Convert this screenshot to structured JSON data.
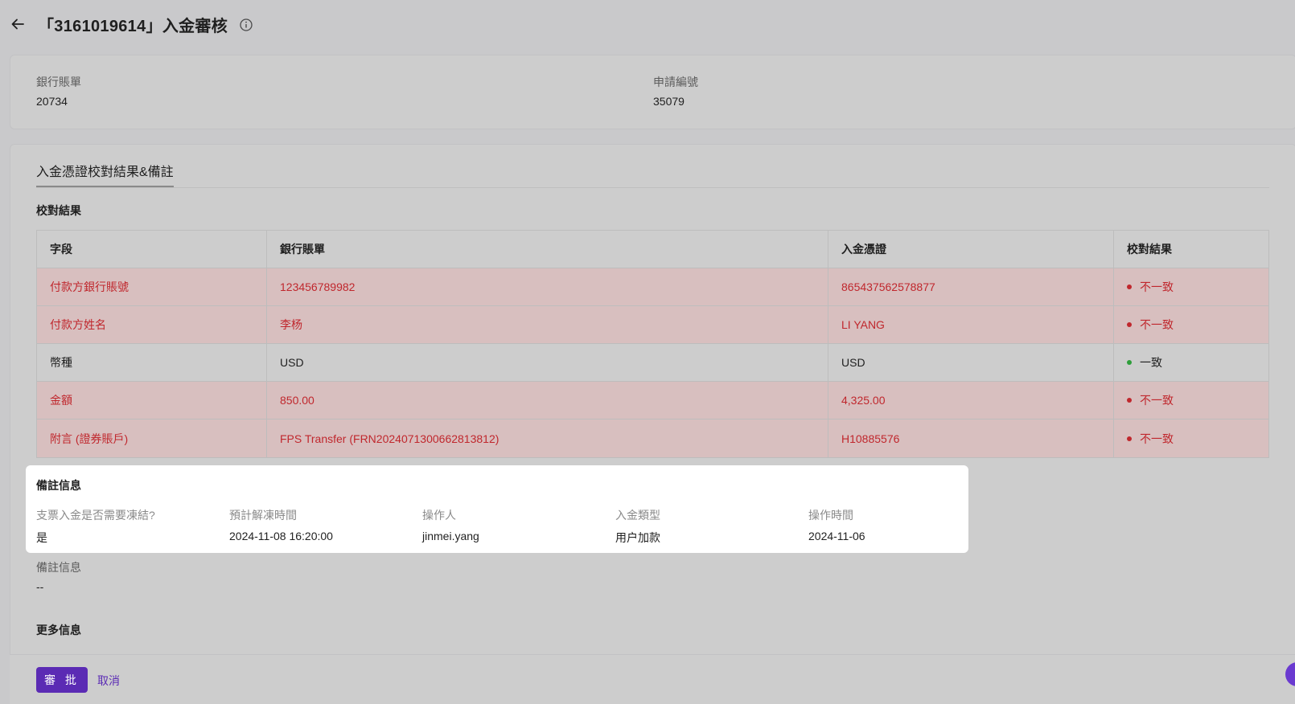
{
  "header": {
    "title": "「3161019614」入金審核"
  },
  "summary": {
    "bank_statement_label": "銀行賬單",
    "bank_statement_value": "20734",
    "application_no_label": "申請編號",
    "application_no_value": "35079"
  },
  "tab": {
    "label": "入金憑證校對結果&備註"
  },
  "comparison": {
    "title": "校對結果",
    "columns": [
      "字段",
      "銀行賬單",
      "入金憑證",
      "校對結果"
    ],
    "rows": [
      {
        "field": "付款方銀行賬號",
        "bank": "123456789982",
        "voucher": "865437562578877",
        "result": "不一致",
        "match": false
      },
      {
        "field": "付款方姓名",
        "bank": "李杨",
        "voucher": "LI YANG",
        "result": "不一致",
        "match": false
      },
      {
        "field": "幣種",
        "bank": "USD",
        "voucher": "USD",
        "result": "一致",
        "match": true
      },
      {
        "field": "金額",
        "bank": "850.00",
        "voucher": "4,325.00",
        "result": "不一致",
        "match": false
      },
      {
        "field": "附言 (證券賬戶)",
        "bank": "FPS Transfer (FRN20240713006628138​12)",
        "voucher": "H10885576",
        "result": "不一致",
        "match": false
      }
    ]
  },
  "remark_box": {
    "title": "備註信息",
    "fields": [
      {
        "label": "支票入金是否需要凍結?",
        "value": "是"
      },
      {
        "label": "預計解凍時間",
        "value": "2024-11-08 16:20:00"
      },
      {
        "label": "操作人",
        "value": "jinmei.yang"
      },
      {
        "label": "入金類型",
        "value": "用户加款"
      },
      {
        "label": "操作時間",
        "value": "2024-11-06"
      }
    ]
  },
  "remark": {
    "label": "備註信息",
    "value": "--"
  },
  "more_info": {
    "title": "更多信息"
  },
  "footer": {
    "approve_label": "審 批",
    "cancel_label": "取消"
  },
  "colors": {
    "accent": "#5b2bb4",
    "mismatch": "#c0272d",
    "match": "#2e9e3a"
  }
}
